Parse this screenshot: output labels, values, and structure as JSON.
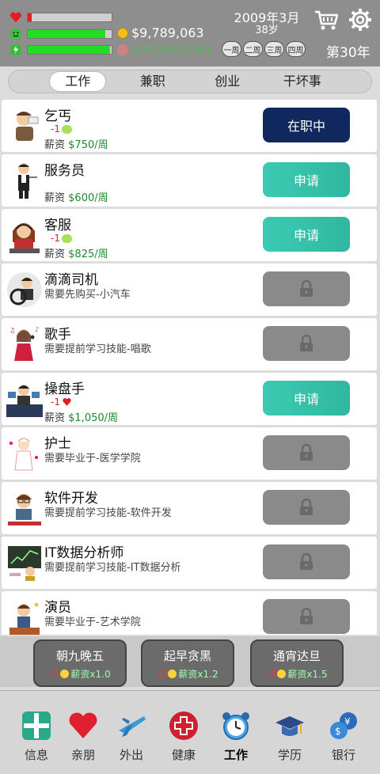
{
  "status": {
    "health": 0.05,
    "happiness": 0.92,
    "energy": 0.98,
    "money": "$9,789,063",
    "hidden_money": "$99,844,061",
    "date": "2009年3月",
    "age": "38岁",
    "weeks": [
      "一周",
      "二周",
      "三周",
      "四周"
    ],
    "year": "第30年",
    "icons": {
      "health": "heart-icon",
      "happiness": "smiley-icon",
      "energy": "energy-icon",
      "cart": "cart-icon",
      "settings": "gear-icon"
    }
  },
  "tabs": [
    {
      "label": "工作",
      "active": true
    },
    {
      "label": "兼职",
      "active": false
    },
    {
      "label": "创业",
      "active": false
    },
    {
      "label": "干坏事",
      "active": false
    }
  ],
  "jobs": [
    {
      "title": "乞丐",
      "cost": "-1",
      "salary_label": "薪资",
      "salary": "$750/周",
      "button": "在职中",
      "state": "current"
    },
    {
      "title": "服务员",
      "salary_label": "薪资",
      "salary": "$600/周",
      "button": "申请",
      "state": "apply"
    },
    {
      "title": "客服",
      "cost": "-1",
      "salary_label": "薪资",
      "salary": "$825/周",
      "button": "申请",
      "state": "apply"
    },
    {
      "title": "滴滴司机",
      "requirement": "需要先购买-小汽车",
      "state": "locked"
    },
    {
      "title": "歌手",
      "requirement": "需要提前学习技能-唱歌",
      "state": "locked"
    },
    {
      "title": "操盘手",
      "cost": "-1",
      "salary_label": "薪资",
      "salary": "$1,050/周",
      "button": "申请",
      "state": "apply"
    },
    {
      "title": "护士",
      "requirement": "需要毕业于-医学学院",
      "state": "locked"
    },
    {
      "title": "软件开发",
      "requirement": "需要提前学习技能-软件开发",
      "state": "locked"
    },
    {
      "title": "IT数据分析师",
      "requirement": "需要提前学习技能-IT数据分析",
      "state": "locked"
    },
    {
      "title": "演员",
      "requirement": "需要毕业于-艺术学院",
      "state": "locked"
    }
  ],
  "work_styles": [
    {
      "name": "朝九晚五",
      "cost": "-1",
      "effect": "薪资x1.0"
    },
    {
      "name": "起早贪黑",
      "cost": "-2",
      "effect": "薪资x1.2"
    },
    {
      "name": "通宵达旦",
      "cost": "-3",
      "effect": "薪资x1.5"
    }
  ],
  "nav": [
    {
      "label": "信息",
      "icon": "info-icon"
    },
    {
      "label": "亲朋",
      "icon": "heart-icon"
    },
    {
      "label": "外出",
      "icon": "plane-icon"
    },
    {
      "label": "健康",
      "icon": "medical-cross-icon"
    },
    {
      "label": "工作",
      "icon": "alarm-clock-icon",
      "active": true
    },
    {
      "label": "学历",
      "icon": "graduation-cap-icon"
    },
    {
      "label": "银行",
      "icon": "bank-coins-icon"
    }
  ]
}
